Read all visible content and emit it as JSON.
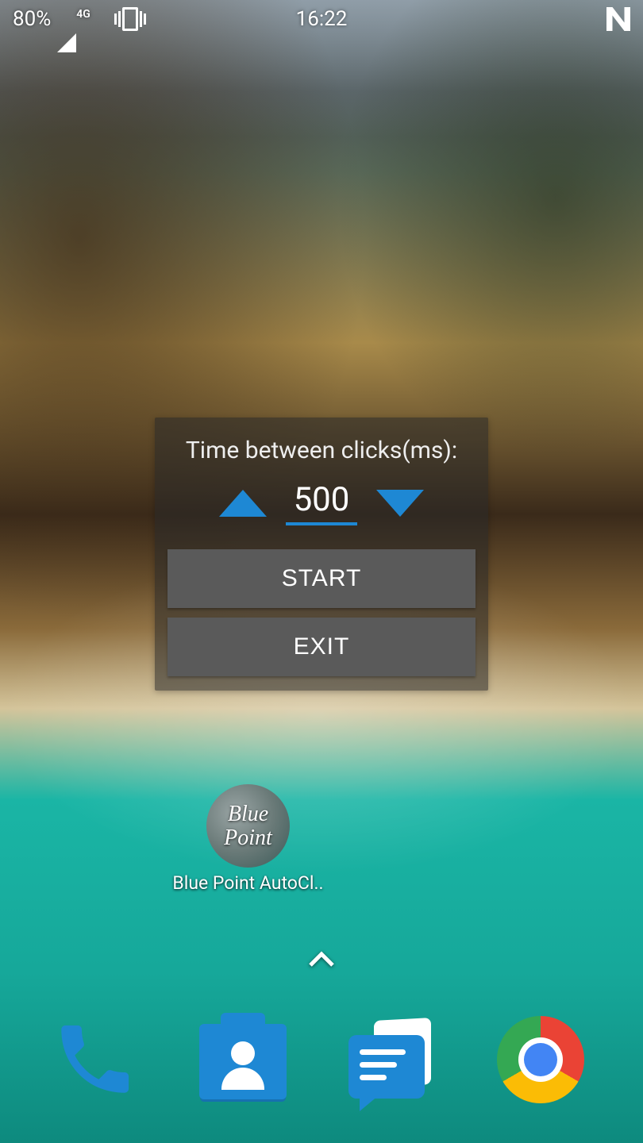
{
  "status_bar": {
    "battery": "80%",
    "network": "4G",
    "time": "16:22"
  },
  "panel": {
    "label": "Time between clicks(ms):",
    "interval_value": "500",
    "start_label": "START",
    "exit_label": "EXIT"
  },
  "home_icon": {
    "line1": "Blue",
    "line2": "Point",
    "label": "Blue Point AutoCl.."
  },
  "dock": {
    "phone": "phone-icon",
    "contacts": "contacts-icon",
    "messages": "messages-icon",
    "chrome": "chrome-icon"
  },
  "colors": {
    "accent": "#1e88d4",
    "button_bg": "#5a5a5a"
  }
}
